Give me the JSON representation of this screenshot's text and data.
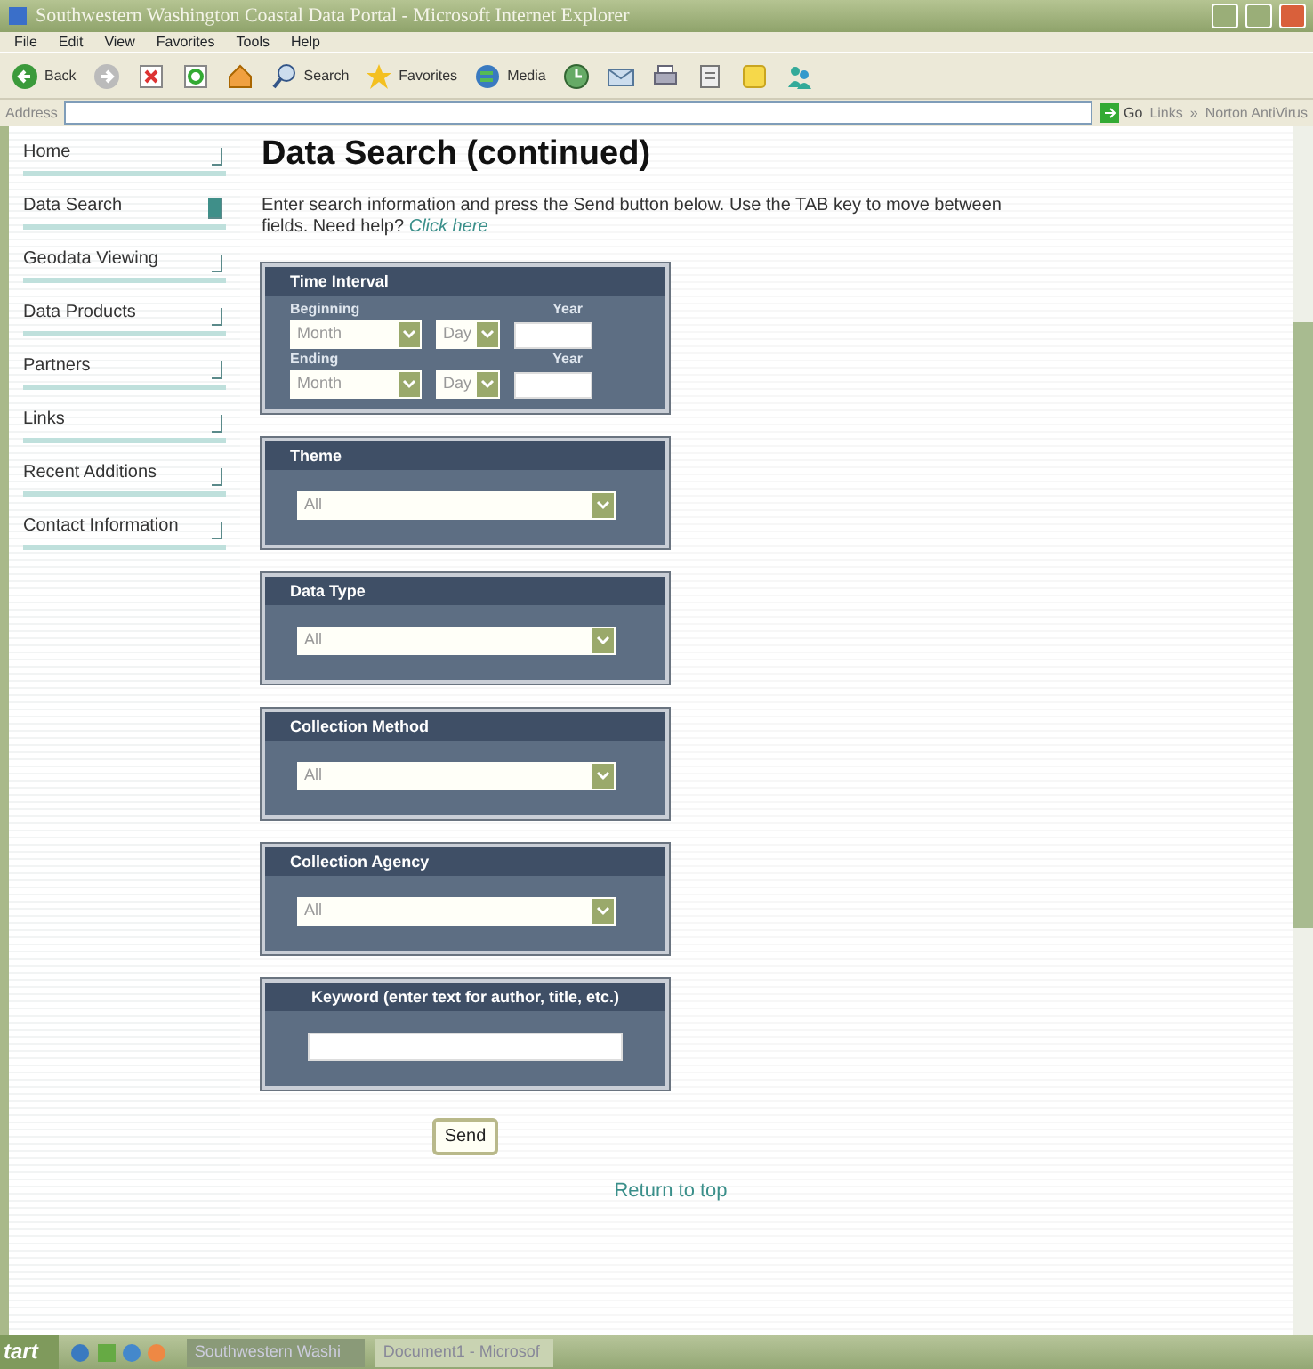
{
  "window": {
    "title": "Southwestern Washington Coastal Data Portal - Microsoft Internet Explorer"
  },
  "menu": [
    "File",
    "Edit",
    "View",
    "Favorites",
    "Tools",
    "Help"
  ],
  "toolbar": [
    {
      "kind": "back",
      "label": "Back"
    },
    {
      "kind": "forward"
    },
    {
      "kind": "stop"
    },
    {
      "kind": "refresh"
    },
    {
      "kind": "home"
    },
    {
      "kind": "search",
      "label": "Search"
    },
    {
      "kind": "favorites",
      "label": "Favorites"
    },
    {
      "kind": "media",
      "label": "Media"
    },
    {
      "kind": "history"
    },
    {
      "kind": "mail"
    },
    {
      "kind": "print"
    },
    {
      "kind": "edit"
    },
    {
      "kind": "note"
    },
    {
      "kind": "people"
    }
  ],
  "address_bar": {
    "label": "Address",
    "go": "Go",
    "links": "Links",
    "chevron": "»",
    "toolbar_item": "Norton AntiVirus"
  },
  "sidebar": {
    "items": [
      {
        "label": "Home",
        "selected": false
      },
      {
        "label": "Data Search",
        "selected": true
      },
      {
        "label": "Geodata Viewing",
        "selected": false
      },
      {
        "label": "Data Products",
        "selected": false
      },
      {
        "label": "Partners",
        "selected": false
      },
      {
        "label": "Links",
        "selected": false
      },
      {
        "label": "Recent Additions",
        "selected": false
      },
      {
        "label": "Contact Information",
        "selected": false
      }
    ]
  },
  "main": {
    "heading": "Data Search (continued)",
    "intro": "Enter search information and press the Send button below. Use the TAB key to move between fields. Need help?",
    "help_link": "Click here",
    "time_interval": {
      "title": "Time Interval",
      "rows": [
        {
          "label": "Beginning",
          "month": "Month",
          "day": "Day",
          "year_label": "Year"
        },
        {
          "label": "Ending",
          "month": "Month",
          "day": "Day",
          "year_label": "Year"
        }
      ]
    },
    "select_panels": [
      {
        "title": "Theme",
        "value": "All"
      },
      {
        "title": "Data Type",
        "value": "All"
      },
      {
        "title": "Collection Method",
        "value": "All"
      },
      {
        "title": "Collection Agency",
        "value": "All"
      }
    ],
    "keyword_panel": {
      "title": "Keyword (enter text for author, title, etc.)"
    },
    "send_button": "Send",
    "return_link": "Return to top"
  },
  "taskbar": {
    "start": "tart",
    "tasks": [
      {
        "label": "Southwestern Washi",
        "selected": true
      },
      {
        "label": "Document1 - Microsof",
        "selected": false
      }
    ]
  }
}
